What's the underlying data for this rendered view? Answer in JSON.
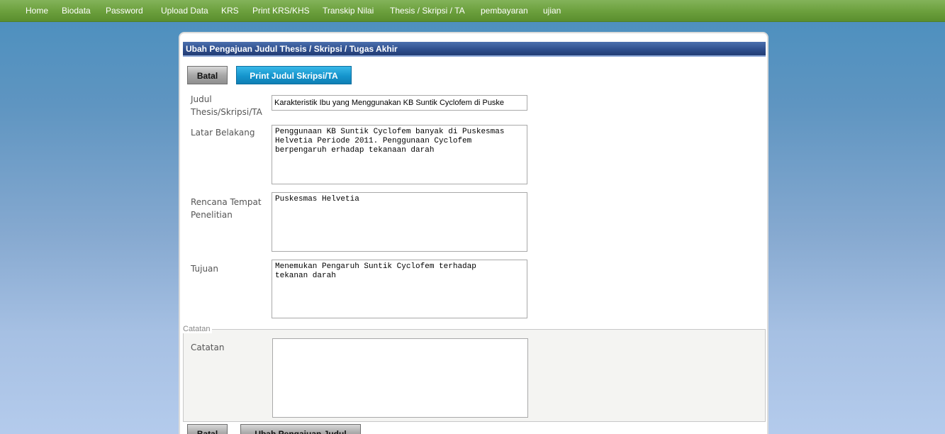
{
  "nav": {
    "items": [
      {
        "label": "Home"
      },
      {
        "label": "Biodata"
      },
      {
        "label": "Password"
      },
      {
        "label": "Upload Data"
      },
      {
        "label": "KRS"
      },
      {
        "label": "Print KRS/KHS"
      },
      {
        "label": "Transkip Nilai"
      },
      {
        "label": "Thesis / Skripsi / TA"
      },
      {
        "label": "pembayaran"
      },
      {
        "label": "ujian"
      }
    ]
  },
  "panel": {
    "title": "Ubah Pengajuan Judul Thesis / Skripsi / Tugas Akhir",
    "batal_label": "Batal",
    "print_label": "Print Judul Skripsi/TA"
  },
  "form": {
    "judul_label_1": "Judul",
    "judul_label_2": "Thesis/Skripsi/TA",
    "judul_value": "Karakteristik Ibu yang Menggunakan KB Suntik Cyclofem di Puske",
    "latar_label": "Latar Belakang",
    "latar_value": "Penggunaan KB Suntik Cyclofem banyak di Puskesmas\nHelvetia Periode 2011. Penggunaan Cyclofem\nberpengaruh erhadap tekanaan darah",
    "rencana_label_1": "Rencana Tempat",
    "rencana_label_2": "Penelitian",
    "rencana_value": "Puskesmas Helvetia",
    "tujuan_label": "Tujuan",
    "tujuan_value": "Menemukan Pengaruh Suntik Cyclofem terhadap\ntekanan darah"
  },
  "catatan": {
    "legend": "Catatan",
    "label": "Catatan",
    "value": ""
  },
  "bottom": {
    "batal_label": "Batal",
    "ubah_label": "Ubah Pengajuan Judul"
  },
  "colors": {
    "nav_green": "#6b9f3c",
    "header_blue": "#2f4f8e",
    "button_blue": "#1595cd"
  }
}
